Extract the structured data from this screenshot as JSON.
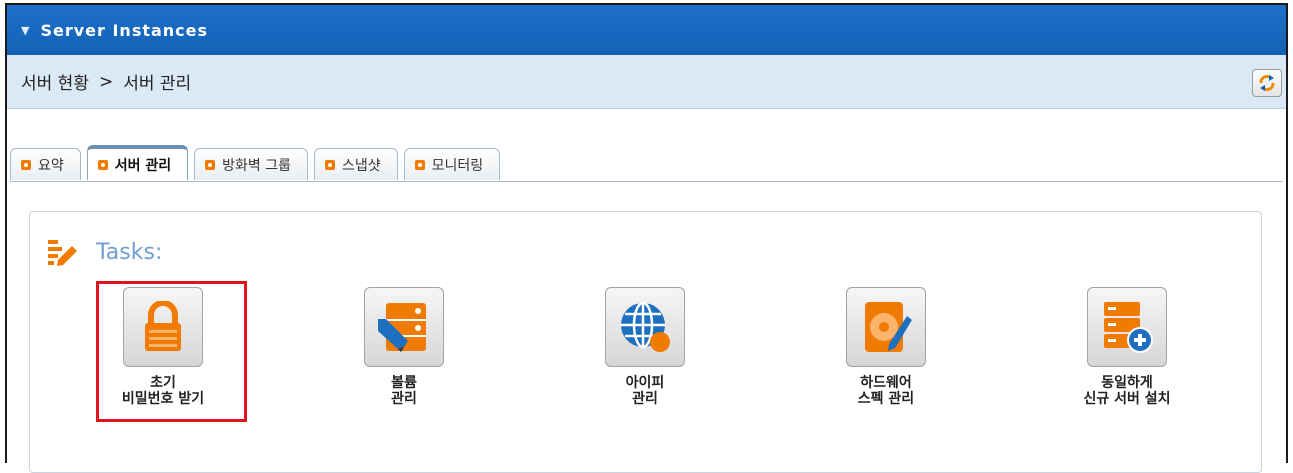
{
  "window": {
    "title": "Server Instances"
  },
  "breadcrumb": {
    "parent": "서버 현황",
    "separator": ">",
    "current": "서버 관리"
  },
  "tabs": [
    {
      "label": "요약",
      "active": false
    },
    {
      "label": "서버 관리",
      "active": true
    },
    {
      "label": "방화벽 그룹",
      "active": false
    },
    {
      "label": "스냅샷",
      "active": false
    },
    {
      "label": "모니터링",
      "active": false
    }
  ],
  "tasks_panel": {
    "title": "Tasks:",
    "items": [
      {
        "line1": "초기",
        "line2": "비밀번호 받기",
        "icon": "lock-icon",
        "highlighted": true
      },
      {
        "line1": "볼륨",
        "line2": "관리",
        "icon": "server-edit-icon"
      },
      {
        "line1": "아이피",
        "line2": "관리",
        "icon": "globe-icon"
      },
      {
        "line1": "하드웨어",
        "line2": "스펙 관리",
        "icon": "hard-disk-edit-icon"
      },
      {
        "line1": "동일하게",
        "line2": "신규 서버 설치",
        "icon": "server-add-icon"
      }
    ]
  },
  "colors": {
    "accent": "#f07b00",
    "titlebar": "#1668be",
    "highlight": "#e1141e",
    "tasks_title": "#6f9fd0"
  }
}
